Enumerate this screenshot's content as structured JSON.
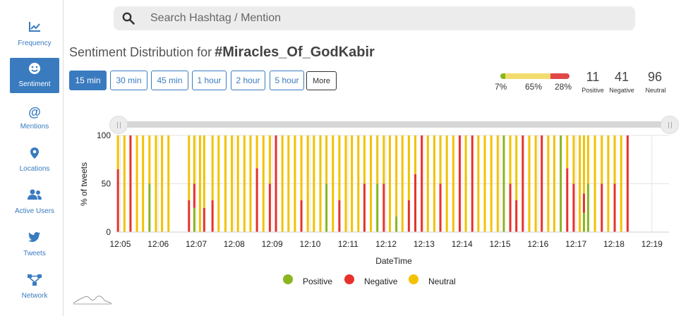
{
  "sidebar": {
    "items": [
      {
        "label": "Frequency",
        "icon": "line-chart-icon"
      },
      {
        "label": "Sentiment",
        "icon": "smile-icon"
      },
      {
        "label": "Mentions",
        "icon": "at-icon"
      },
      {
        "label": "Locations",
        "icon": "map-marker-icon"
      },
      {
        "label": "Active Users",
        "icon": "users-icon"
      },
      {
        "label": "Tweets",
        "icon": "twitter-icon"
      },
      {
        "label": "Network",
        "icon": "network-icon"
      }
    ]
  },
  "search": {
    "placeholder": "Search Hashtag / Mention"
  },
  "header": {
    "title_prefix": "Sentiment Distribution for",
    "hashtag": "#Miracles_Of_GodKabir"
  },
  "intervals": [
    "15 min",
    "30 min",
    "45 min",
    "1 hour",
    "2 hour",
    "5 hour"
  ],
  "more_label": "More",
  "summary": {
    "positive_pct": "7%",
    "neutral_pct": "65%",
    "negative_pct": "28%",
    "positive_count": "11",
    "negative_count": "41",
    "neutral_count": "96",
    "positive_label": "Positive",
    "negative_label": "Negative",
    "neutral_label": "Neutral"
  },
  "colors": {
    "accent": "#3a7bbf",
    "positive": "#8ab51d",
    "negative": "#e8312b",
    "neutral": "#f2c200"
  },
  "legend": [
    "Positive",
    "Negative",
    "Neutral"
  ],
  "chart_data": {
    "type": "bar",
    "stacked": true,
    "ylabel": "% of tweets",
    "xlabel": "DateTime",
    "ylim": [
      0,
      100
    ],
    "yticks": [
      0,
      50,
      100
    ],
    "xticks": [
      "12:05",
      "12:06",
      "12:07",
      "12:08",
      "12:09",
      "12:10",
      "12:11",
      "12:12",
      "12:13",
      "12:14",
      "12:15",
      "12:16",
      "12:17",
      "12:18",
      "12:19"
    ],
    "grid": true,
    "legend_position": "bottom",
    "xdomain_minutes": [
      4.9,
      19.45
    ],
    "bars": [
      {
        "t": 4.94,
        "pos": 0,
        "neg": 65,
        "neu": 35
      },
      {
        "t": 5.11,
        "pos": 0,
        "neg": 0,
        "neu": 100
      },
      {
        "t": 5.27,
        "pos": 0,
        "neg": 100,
        "neu": 0
      },
      {
        "t": 5.44,
        "pos": 0,
        "neg": 0,
        "neu": 100
      },
      {
        "t": 5.6,
        "pos": 0,
        "neg": 0,
        "neu": 100
      },
      {
        "t": 5.77,
        "pos": 50,
        "neg": 0,
        "neu": 50
      },
      {
        "t": 5.94,
        "pos": 0,
        "neg": 0,
        "neu": 100
      },
      {
        "t": 6.1,
        "pos": 0,
        "neg": 0,
        "neu": 100
      },
      {
        "t": 6.27,
        "pos": 0,
        "neg": 0,
        "neu": 100
      },
      {
        "t": 6.81,
        "pos": 0,
        "neg": 33,
        "neu": 67
      },
      {
        "t": 6.95,
        "pos": 25,
        "neg": 25,
        "neu": 50
      },
      {
        "t": 7.1,
        "pos": 0,
        "neg": 0,
        "neu": 100
      },
      {
        "t": 7.21,
        "pos": 0,
        "neg": 25,
        "neu": 75
      },
      {
        "t": 7.43,
        "pos": 0,
        "neg": 33,
        "neu": 67
      },
      {
        "t": 7.59,
        "pos": 0,
        "neg": 0,
        "neu": 100
      },
      {
        "t": 7.77,
        "pos": 0,
        "neg": 0,
        "neu": 100
      },
      {
        "t": 7.94,
        "pos": 0,
        "neg": 0,
        "neu": 100
      },
      {
        "t": 8.1,
        "pos": 0,
        "neg": 0,
        "neu": 100
      },
      {
        "t": 8.27,
        "pos": 0,
        "neg": 0,
        "neu": 100
      },
      {
        "t": 8.43,
        "pos": 0,
        "neg": 0,
        "neu": 100
      },
      {
        "t": 8.6,
        "pos": 0,
        "neg": 66,
        "neu": 34
      },
      {
        "t": 8.77,
        "pos": 0,
        "neg": 0,
        "neu": 100
      },
      {
        "t": 8.94,
        "pos": 0,
        "neg": 50,
        "neu": 50
      },
      {
        "t": 9.1,
        "pos": 0,
        "neg": 100,
        "neu": 0
      },
      {
        "t": 9.27,
        "pos": 0,
        "neg": 0,
        "neu": 100
      },
      {
        "t": 9.43,
        "pos": 0,
        "neg": 0,
        "neu": 100
      },
      {
        "t": 9.6,
        "pos": 0,
        "neg": 0,
        "neu": 100
      },
      {
        "t": 9.77,
        "pos": 0,
        "neg": 33,
        "neu": 67
      },
      {
        "t": 9.94,
        "pos": 0,
        "neg": 0,
        "neu": 100
      },
      {
        "t": 10.1,
        "pos": 0,
        "neg": 0,
        "neu": 100
      },
      {
        "t": 10.27,
        "pos": 0,
        "neg": 0,
        "neu": 100
      },
      {
        "t": 10.43,
        "pos": 50,
        "neg": 0,
        "neu": 50
      },
      {
        "t": 10.6,
        "pos": 0,
        "neg": 0,
        "neu": 100
      },
      {
        "t": 10.77,
        "pos": 0,
        "neg": 33,
        "neu": 67
      },
      {
        "t": 10.94,
        "pos": 0,
        "neg": 0,
        "neu": 100
      },
      {
        "t": 11.1,
        "pos": 0,
        "neg": 0,
        "neu": 100
      },
      {
        "t": 11.27,
        "pos": 0,
        "neg": 0,
        "neu": 100
      },
      {
        "t": 11.43,
        "pos": 0,
        "neg": 50,
        "neu": 50
      },
      {
        "t": 11.6,
        "pos": 0,
        "neg": 0,
        "neu": 100
      },
      {
        "t": 11.77,
        "pos": 50,
        "neg": 0,
        "neu": 50
      },
      {
        "t": 11.94,
        "pos": 0,
        "neg": 50,
        "neu": 50
      },
      {
        "t": 12.1,
        "pos": 0,
        "neg": 0,
        "neu": 100
      },
      {
        "t": 12.27,
        "pos": 16,
        "neg": 0,
        "neu": 84
      },
      {
        "t": 12.43,
        "pos": 0,
        "neg": 0,
        "neu": 100
      },
      {
        "t": 12.6,
        "pos": 0,
        "neg": 33,
        "neu": 67
      },
      {
        "t": 12.77,
        "pos": 0,
        "neg": 60,
        "neu": 40
      },
      {
        "t": 12.94,
        "pos": 0,
        "neg": 100,
        "neu": 0
      },
      {
        "t": 13.1,
        "pos": 0,
        "neg": 0,
        "neu": 100
      },
      {
        "t": 13.27,
        "pos": 0,
        "neg": 0,
        "neu": 100
      },
      {
        "t": 13.43,
        "pos": 0,
        "neg": 50,
        "neu": 50
      },
      {
        "t": 13.6,
        "pos": 0,
        "neg": 0,
        "neu": 100
      },
      {
        "t": 13.77,
        "pos": 0,
        "neg": 0,
        "neu": 100
      },
      {
        "t": 13.94,
        "pos": 0,
        "neg": 100,
        "neu": 0
      },
      {
        "t": 14.1,
        "pos": 0,
        "neg": 0,
        "neu": 100
      },
      {
        "t": 14.27,
        "pos": 0,
        "neg": 100,
        "neu": 0
      },
      {
        "t": 14.43,
        "pos": 0,
        "neg": 0,
        "neu": 100
      },
      {
        "t": 14.6,
        "pos": 0,
        "neg": 0,
        "neu": 100
      },
      {
        "t": 14.77,
        "pos": 0,
        "neg": 0,
        "neu": 100
      },
      {
        "t": 14.94,
        "pos": 0,
        "neg": 0,
        "neu": 100
      },
      {
        "t": 15.1,
        "pos": 100,
        "neg": 0,
        "neu": 0
      },
      {
        "t": 15.27,
        "pos": 0,
        "neg": 50,
        "neu": 50
      },
      {
        "t": 15.43,
        "pos": 0,
        "neg": 33,
        "neu": 67
      },
      {
        "t": 15.6,
        "pos": 0,
        "neg": 100,
        "neu": 0
      },
      {
        "t": 15.77,
        "pos": 0,
        "neg": 0,
        "neu": 100
      },
      {
        "t": 15.94,
        "pos": 0,
        "neg": 0,
        "neu": 100
      },
      {
        "t": 16.1,
        "pos": 0,
        "neg": 100,
        "neu": 0
      },
      {
        "t": 16.27,
        "pos": 0,
        "neg": 0,
        "neu": 100
      },
      {
        "t": 16.43,
        "pos": 0,
        "neg": 0,
        "neu": 100
      },
      {
        "t": 16.6,
        "pos": 100,
        "neg": 0,
        "neu": 0
      },
      {
        "t": 16.77,
        "pos": 0,
        "neg": 66,
        "neu": 34
      },
      {
        "t": 16.94,
        "pos": 0,
        "neg": 50,
        "neu": 50
      },
      {
        "t": 17.1,
        "pos": 0,
        "neg": 0,
        "neu": 100
      },
      {
        "t": 17.21,
        "pos": 20,
        "neg": 20,
        "neu": 60
      },
      {
        "t": 17.32,
        "pos": 50,
        "neg": 0,
        "neu": 50
      },
      {
        "t": 17.5,
        "pos": 0,
        "neg": 0,
        "neu": 100
      },
      {
        "t": 17.68,
        "pos": 0,
        "neg": 50,
        "neu": 50
      },
      {
        "t": 17.85,
        "pos": 0,
        "neg": 0,
        "neu": 100
      },
      {
        "t": 18.02,
        "pos": 0,
        "neg": 50,
        "neu": 50
      },
      {
        "t": 18.19,
        "pos": 0,
        "neg": 0,
        "neu": 100
      },
      {
        "t": 18.36,
        "pos": 0,
        "neg": 100,
        "neu": 0
      }
    ]
  }
}
